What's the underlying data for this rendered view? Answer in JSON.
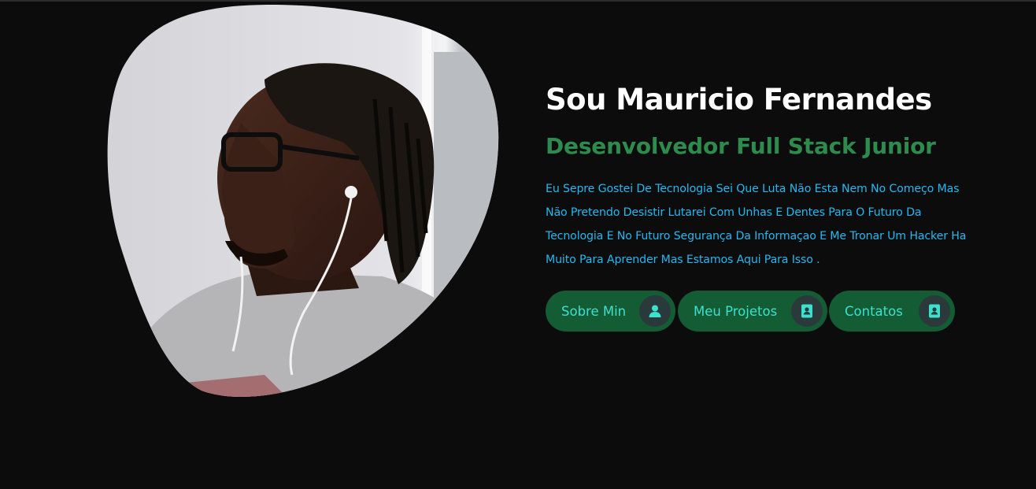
{
  "profile": {
    "name": "Sou Mauricio Fernandes",
    "role": "Desenvolvedor Full Stack Junior",
    "bio": "Eu Sepre Gostei De Tecnologia Sei Que Luta Não Esta Nem No Começo Mas Não Pretendo Desistir Lutarei Com Unhas E Dentes Para O Futuro Da Tecnologia E No Futuro Segurança Da Informaçao E Me Tronar Um Hacker Ha Muito Para Aprender Mas Estamos Aqui Para Isso ."
  },
  "buttons": [
    {
      "label": "Sobre Min",
      "icon": "user-icon"
    },
    {
      "label": "Meu Projetos",
      "icon": "contact-book-icon"
    },
    {
      "label": "Contatos",
      "icon": "contact-book-icon"
    }
  ],
  "colors": {
    "background": "#0c0c0c",
    "name": "#ffffff",
    "role": "#2e8b4e",
    "bio": "#22b8f0",
    "button_bg": "#145c33",
    "button_text": "#3ce0cf",
    "icon_circle": "#2a3a3b"
  }
}
